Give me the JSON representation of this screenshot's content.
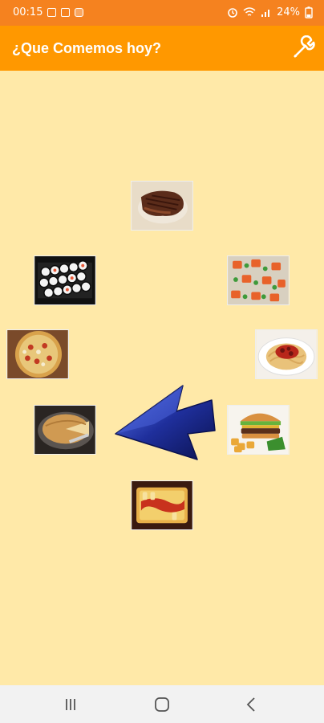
{
  "status_bar": {
    "time": "00:15",
    "battery": "24%"
  },
  "app_bar": {
    "title": "¿Que Comemos hoy?",
    "settings_icon": "wrench-icon"
  },
  "foods": [
    {
      "id": "steak",
      "name": "steak-image"
    },
    {
      "id": "sushi",
      "name": "sushi-image"
    },
    {
      "id": "salad",
      "name": "salad-image"
    },
    {
      "id": "pizza",
      "name": "pizza-image"
    },
    {
      "id": "spaghetti",
      "name": "spaghetti-image"
    },
    {
      "id": "pie",
      "name": "pie-image"
    },
    {
      "id": "burger",
      "name": "burger-image"
    },
    {
      "id": "lasagna",
      "name": "lasagna-image"
    }
  ],
  "spinner": {
    "icon": "arrow-icon",
    "color": "#1a237e"
  },
  "nav_bar": {
    "recents": "recents-icon",
    "home": "home-icon",
    "back": "back-icon"
  },
  "colors": {
    "status": "#F5821F",
    "appbar": "#FF9800",
    "background": "#FFE9A8"
  }
}
